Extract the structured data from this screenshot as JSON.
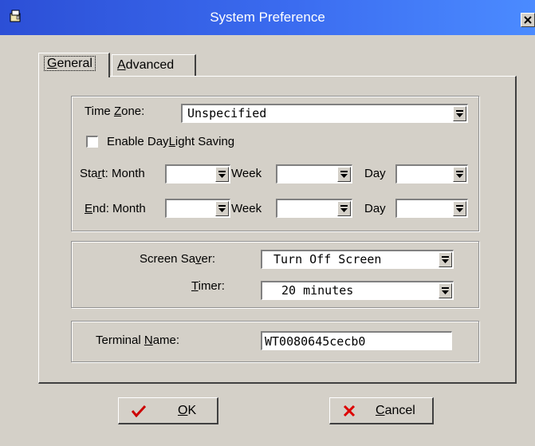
{
  "window": {
    "title": "System Preference"
  },
  "tabs": [
    {
      "label": "General",
      "selected": true
    },
    {
      "label": "Advanced",
      "selected": false
    }
  ],
  "time": {
    "timezone_label": "Time Zone:",
    "timezone_value": "Unspecified",
    "daylight_label": "Enable DayLight Saving",
    "daylight_checked": false,
    "start_label": "Start: Month",
    "end_label": "End: Month",
    "week_label": "Week",
    "day_label": "Day",
    "start_month": "",
    "start_week": "",
    "start_day": "",
    "end_month": "",
    "end_week": "",
    "end_day": ""
  },
  "screen": {
    "saver_label": "Screen Saver:",
    "saver_value": "Turn Off Screen",
    "timer_label": "Timer:",
    "timer_value": "20 minutes"
  },
  "terminal": {
    "name_label": "Terminal Name:",
    "name_value": "WT0080645cecb0"
  },
  "buttons": {
    "ok": "OK",
    "cancel": "Cancel"
  },
  "colors": {
    "title_bar": "#3b6cf0",
    "face": "#d4d0c8",
    "ok_check": "#cc0000",
    "cancel_x": "#dd0000"
  },
  "icons": {
    "title": "settings-hand-icon",
    "close": "close-icon",
    "ok": "checkmark-icon",
    "cancel": "x-icon",
    "dropdown": "dropdown-arrow-icon"
  }
}
